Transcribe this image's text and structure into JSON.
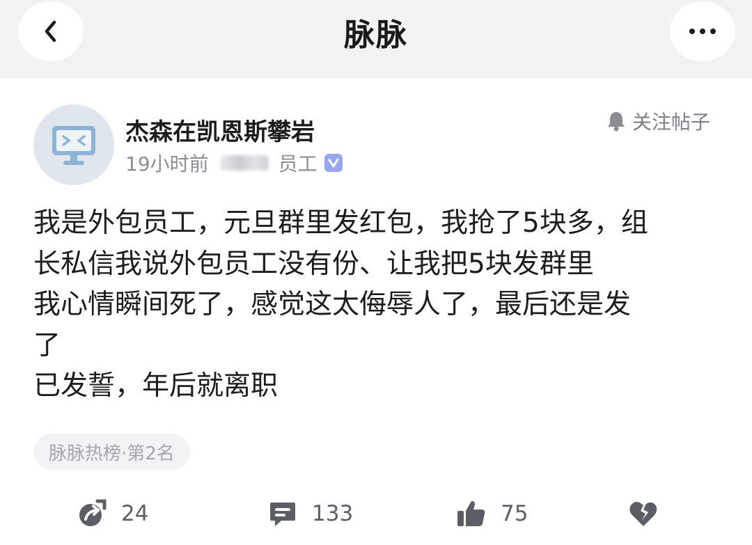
{
  "header": {
    "title": "脉脉",
    "back_icon": "chevron-left-icon",
    "more_icon": "more-dots-icon"
  },
  "post": {
    "author": {
      "name": "杰森在凯恩斯攀岩",
      "time": "19小时前",
      "role": "员工",
      "avatar_icon": "monitor-avatar-icon",
      "verified_icon": "verified-check-icon"
    },
    "follow_label": "关注帖子",
    "content_lines": [
      "我是外包员工，元旦群里发红包，我抢了5块多，组",
      "长私信我说外包员工没有份、让我把5块发群里",
      "我心情瞬间死了，感觉这太侮辱人了，最后还是发",
      "了",
      "已发誓，年后就离职"
    ],
    "tag": "脉脉热榜·第2名",
    "actions": {
      "share_count": "24",
      "comment_count": "133",
      "like_count": "75"
    }
  },
  "colors": {
    "topbar_bg": "#f1f2f4",
    "avatar_bg": "#dfe6ee",
    "avatar_accent": "#8fb3d4",
    "verified": "#9aa6ec",
    "muted_text": "#8a8d93"
  }
}
